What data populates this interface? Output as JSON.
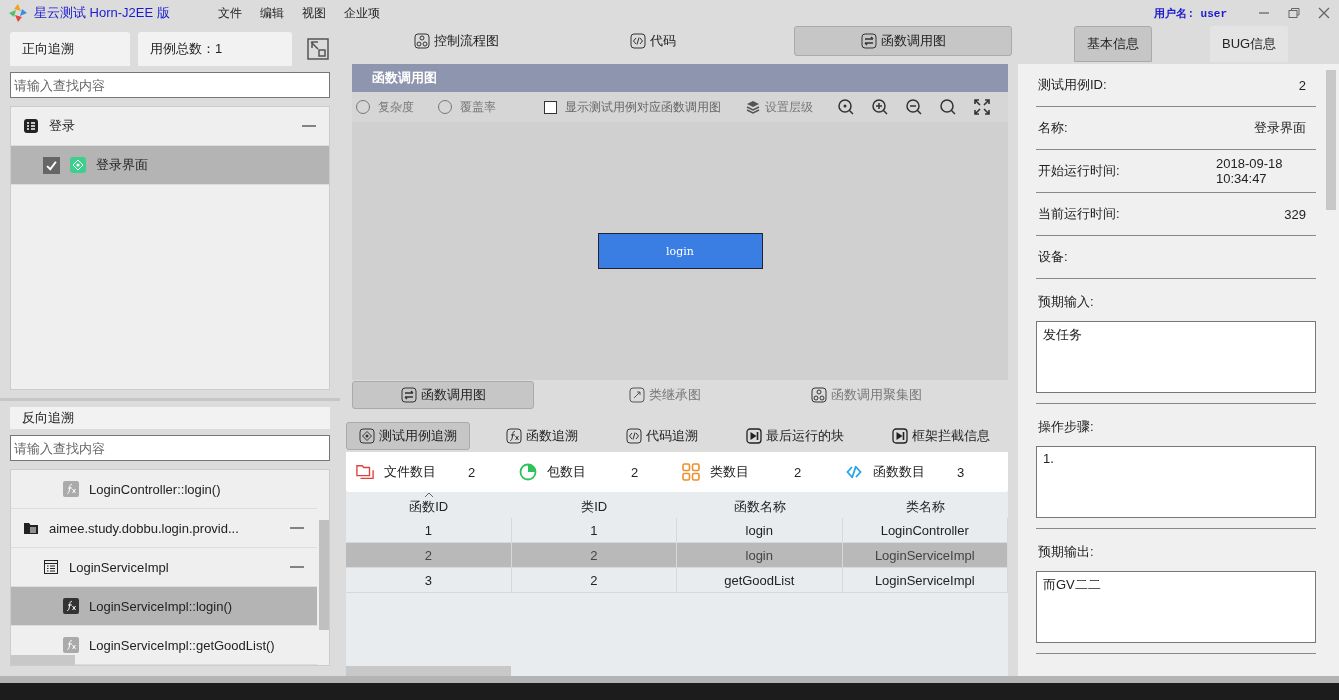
{
  "window": {
    "title": "星云测试 Horn-J2EE 版",
    "menu": [
      "文件",
      "编辑",
      "视图",
      "企业项"
    ],
    "user": "用户名: user"
  },
  "forward": {
    "title": "正向追溯",
    "count": "用例总数：1",
    "search": {
      "placeholder": "请输入查找内容"
    },
    "tree": [
      {
        "label": "登录",
        "kind": "module",
        "expanded": true,
        "selected": false,
        "children": [
          {
            "label": "登录界面",
            "kind": "case",
            "checked": true,
            "selected": true
          }
        ]
      }
    ]
  },
  "backward": {
    "title": "反向追溯",
    "search": {
      "placeholder": "请输入查找内容"
    },
    "tree": [
      {
        "label": "LoginController::login()",
        "kind": "function",
        "selected": false
      },
      {
        "label": "aimee.study.dobbu.login.provid...",
        "kind": "package",
        "expanded": true,
        "selected": false,
        "children": [
          {
            "label": "LoginServiceImpl",
            "kind": "class",
            "expanded": true,
            "selected": false,
            "children": [
              {
                "label": "LoginServiceImpl::login()",
                "kind": "function",
                "selected": true
              },
              {
                "label": "LoginServiceImpl::getGoodList()",
                "kind": "function",
                "selected": false
              }
            ]
          }
        ]
      }
    ]
  },
  "view_tabs": [
    {
      "label": "控制流程图",
      "kind": "flow",
      "selected": false
    },
    {
      "label": "代码",
      "kind": "code",
      "selected": false
    },
    {
      "label": "函数调用图",
      "kind": "call",
      "selected": true
    }
  ],
  "graph": {
    "title": "函数调用图",
    "options": [
      {
        "kind": "radio",
        "label": "复杂度",
        "selected": false
      },
      {
        "kind": "radio",
        "label": "覆盖率",
        "selected": false
      },
      {
        "kind": "checkbox",
        "label": "显示测试用例对应函数调用图",
        "checked": false
      }
    ],
    "level_button": "设置层级",
    "nodes": [
      {
        "label": "login"
      }
    ],
    "bottom_tabs": [
      {
        "label": "函数调用图",
        "kind": "call",
        "selected": true
      },
      {
        "label": "类继承图",
        "kind": "inherit",
        "selected": false
      },
      {
        "label": "函数调用聚集图",
        "kind": "flow",
        "selected": false
      }
    ]
  },
  "trace": {
    "tabs": [
      {
        "label": "测试用例追溯",
        "kind": "case",
        "selected": true
      },
      {
        "label": "函数追溯",
        "kind": "function",
        "selected": false
      },
      {
        "label": "代码追溯",
        "kind": "code",
        "selected": false
      },
      {
        "label": "最后运行的块",
        "kind": "block",
        "selected": false
      },
      {
        "label": "框架拦截信息",
        "kind": "block",
        "selected": false
      }
    ],
    "stats": [
      {
        "label": "文件数目",
        "value": "2",
        "kind": "file"
      },
      {
        "label": "包数目",
        "value": "2",
        "kind": "package"
      },
      {
        "label": "类数目",
        "value": "2",
        "kind": "class"
      },
      {
        "label": "函数数目",
        "value": "3",
        "kind": "function"
      }
    ],
    "table": {
      "columns": [
        {
          "label": "函数ID",
          "sorted": true
        },
        {
          "label": "类ID",
          "sorted": false
        },
        {
          "label": "函数名称",
          "sorted": false
        },
        {
          "label": "类名称",
          "sorted": false
        }
      ],
      "rows": [
        {
          "cells": [
            "1",
            "1",
            "login",
            "LoginController"
          ],
          "selected": false
        },
        {
          "cells": [
            "2",
            "2",
            "login",
            "LoginServiceImpl"
          ],
          "selected": true
        },
        {
          "cells": [
            "3",
            "2",
            "getGoodList",
            "LoginServiceImpl"
          ],
          "selected": false
        }
      ]
    }
  },
  "info_tabs": [
    {
      "label": "基本信息",
      "selected": true
    },
    {
      "label": "BUG信息",
      "selected": false
    }
  ],
  "fields": [
    {
      "kind": "pair",
      "label": "测试用例ID:",
      "value": "2"
    },
    {
      "kind": "pair",
      "label": "名称:",
      "value": "登录界面"
    },
    {
      "kind": "pair",
      "label": "开始运行时间:",
      "value": "2018-09-18 10:34:47"
    },
    {
      "kind": "pair",
      "label": "当前运行时间:",
      "value": "329"
    },
    {
      "kind": "pair",
      "label": "设备:"
    },
    {
      "kind": "text",
      "label": "预期输入:",
      "value": "发任务"
    },
    {
      "kind": "text",
      "label": "操作步骤:",
      "value": "1."
    },
    {
      "kind": "text",
      "label": "预期输出:",
      "value": "而GV二二"
    }
  ]
}
